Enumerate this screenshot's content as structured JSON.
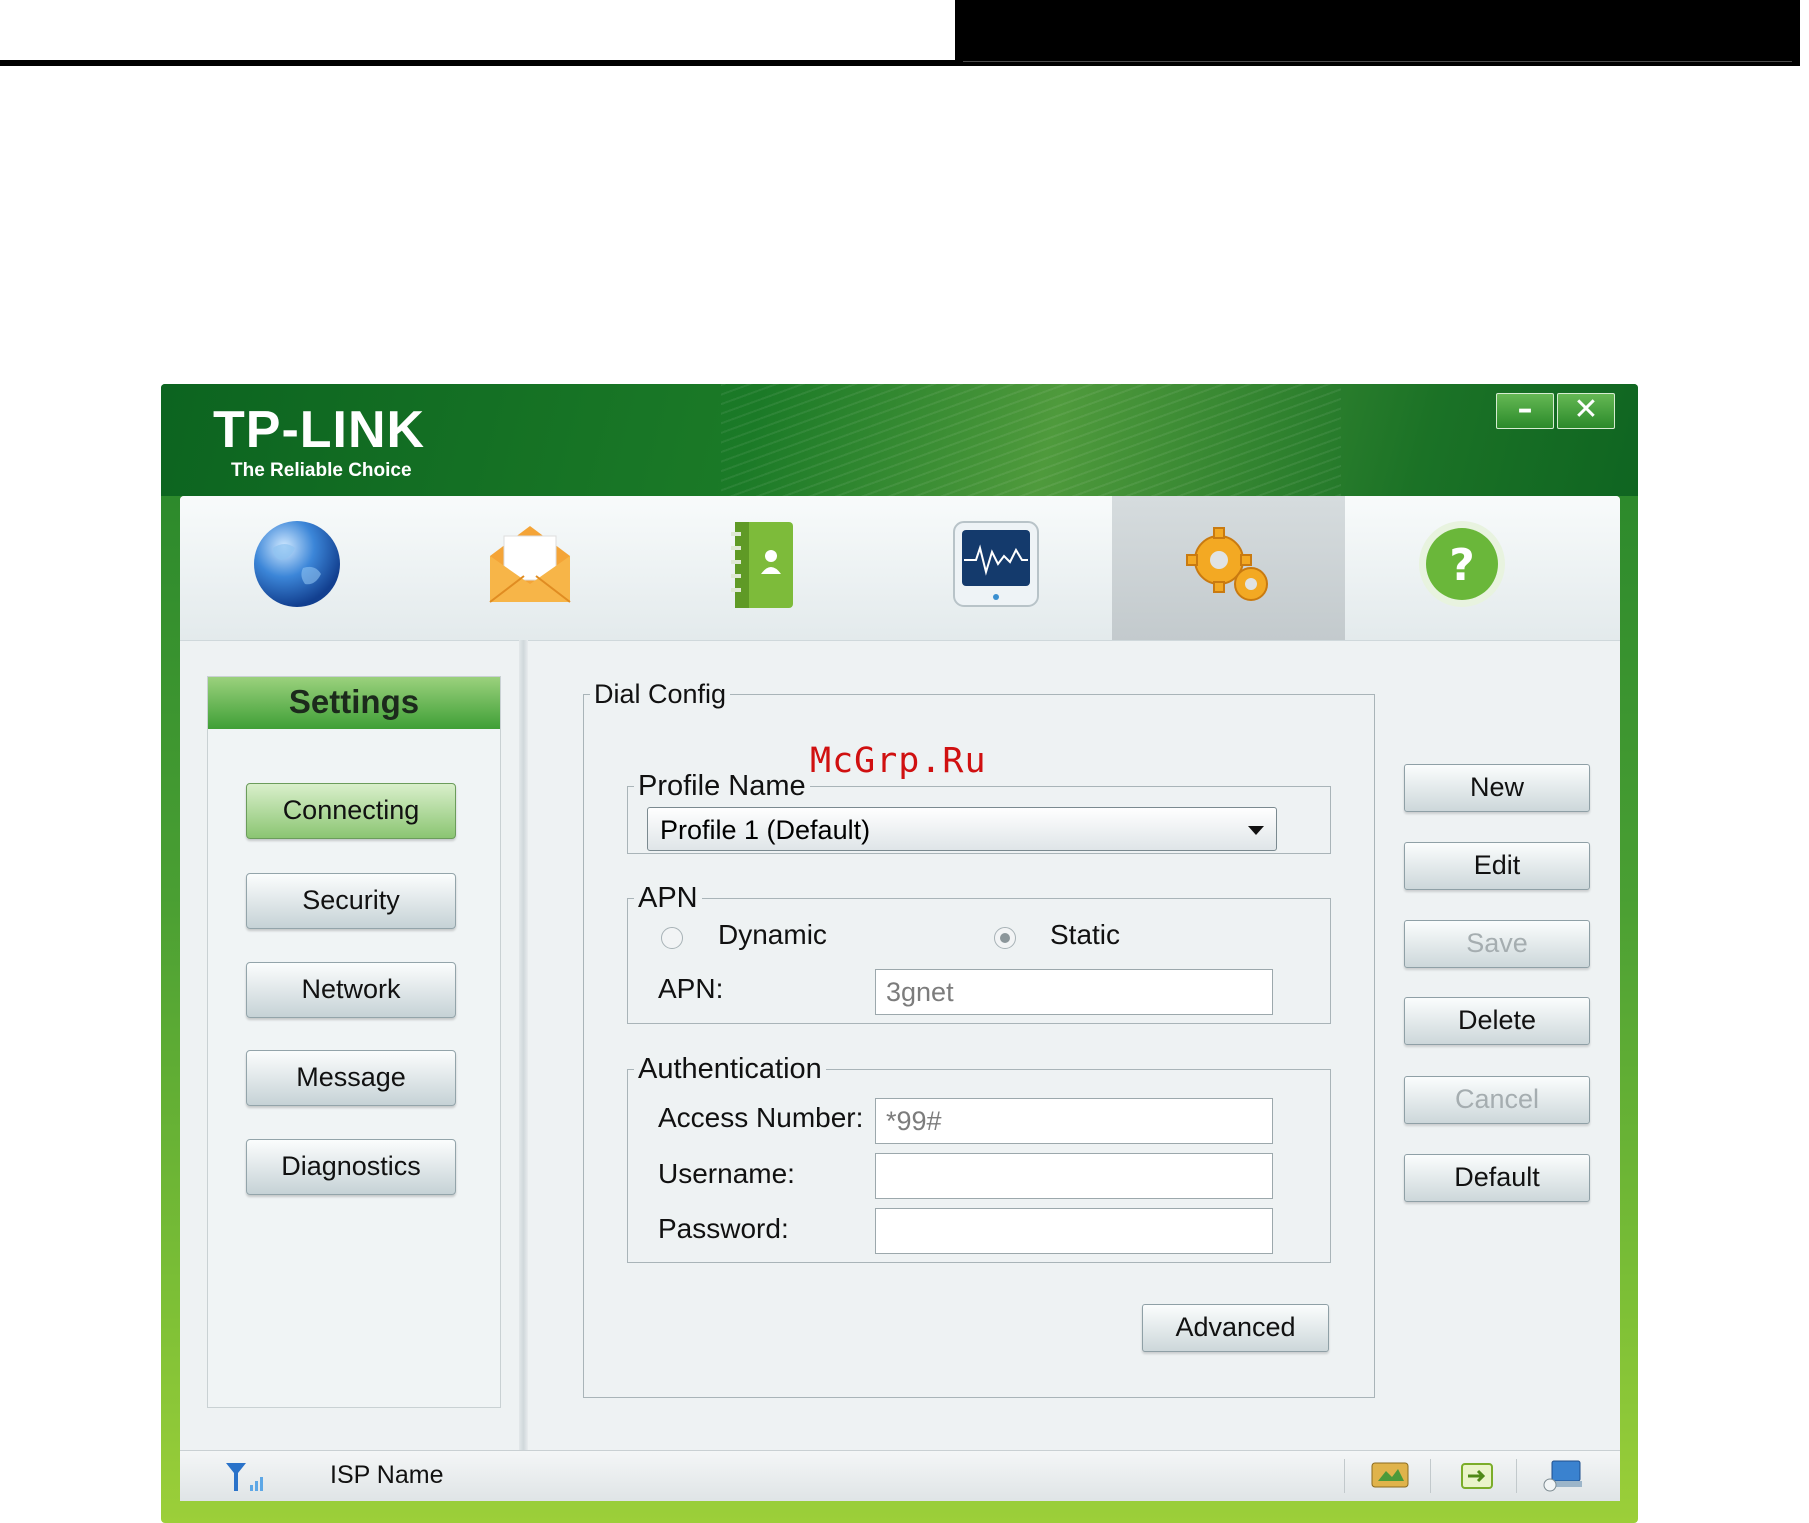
{
  "brand": {
    "logo_text": "TP-LINK",
    "tagline": "The Reliable Choice",
    "colors": {
      "titlebar": "#1b7a27",
      "accent_green": "#4a9f33",
      "frame_bottom": "#9ccf39"
    }
  },
  "window_controls": {
    "minimize_label": "–",
    "close_label": "✕"
  },
  "navbar": {
    "items": [
      {
        "name": "internet",
        "icon": "globe-icon"
      },
      {
        "name": "messages",
        "icon": "envelope-icon"
      },
      {
        "name": "contacts",
        "icon": "phonebook-icon"
      },
      {
        "name": "statistics",
        "icon": "monitor-icon"
      },
      {
        "name": "settings",
        "icon": "gears-icon",
        "active": true
      },
      {
        "name": "help",
        "icon": "help-icon"
      }
    ]
  },
  "sidebar": {
    "title": "Settings",
    "items": [
      {
        "label": "Connecting",
        "active": true
      },
      {
        "label": "Security"
      },
      {
        "label": "Network"
      },
      {
        "label": "Message"
      },
      {
        "label": "Diagnostics"
      }
    ]
  },
  "dial_config": {
    "title": "Dial Config",
    "profile": {
      "legend": "Profile Name",
      "selected": "Profile 1 (Default)"
    },
    "apn": {
      "legend": "APN",
      "dynamic_label": "Dynamic",
      "static_label": "Static",
      "selected_mode": "Static",
      "apn_label": "APN:",
      "apn_value": "3gnet"
    },
    "auth": {
      "legend": "Authentication",
      "access_number_label": "Access Number:",
      "access_number_value": "*99#",
      "username_label": "Username:",
      "username_value": "",
      "password_label": "Password:",
      "password_value": ""
    },
    "advanced_label": "Advanced"
  },
  "actions": [
    {
      "label": "New",
      "enabled": true
    },
    {
      "label": "Edit",
      "enabled": true
    },
    {
      "label": "Save",
      "enabled": false
    },
    {
      "label": "Delete",
      "enabled": true
    },
    {
      "label": "Cancel",
      "enabled": false
    },
    {
      "label": "Default",
      "enabled": true
    }
  ],
  "statusbar": {
    "isp_label": "ISP Name",
    "icons": [
      "signal-icon",
      "sms-status-icon",
      "sim-status-icon",
      "network-status-icon"
    ]
  },
  "watermark": "McGrp.Ru"
}
